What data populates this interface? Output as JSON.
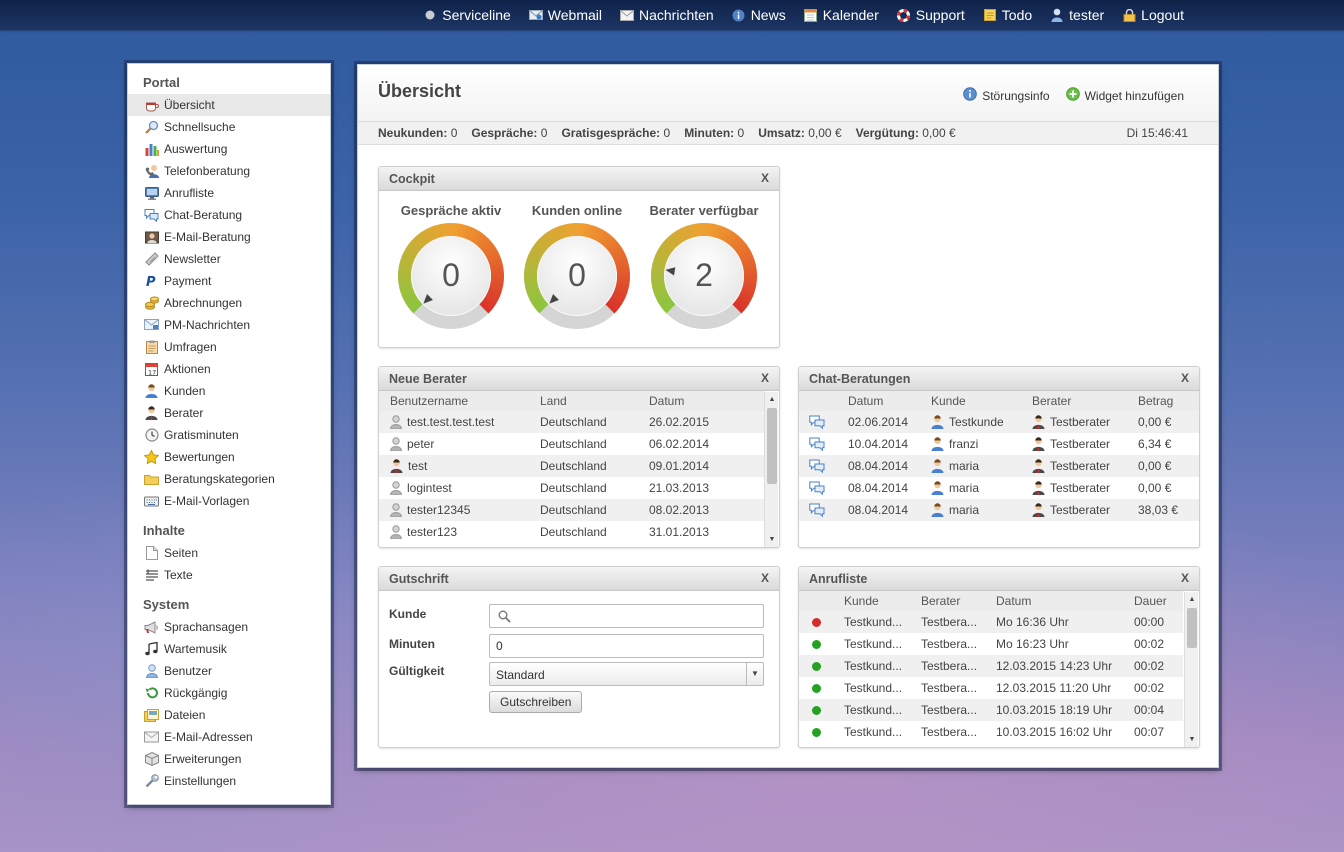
{
  "topnav": [
    {
      "label": "Serviceline",
      "icon": "status-dot-icon"
    },
    {
      "label": "Webmail",
      "icon": "webmail-icon"
    },
    {
      "label": "Nachrichten",
      "icon": "envelope-icon"
    },
    {
      "label": "News",
      "icon": "info-icon"
    },
    {
      "label": "Kalender",
      "icon": "calendar-icon"
    },
    {
      "label": "Support",
      "icon": "lifebuoy-icon"
    },
    {
      "label": "Todo",
      "icon": "note-icon"
    },
    {
      "label": "tester",
      "icon": "user-icon"
    },
    {
      "label": "Logout",
      "icon": "lock-icon"
    }
  ],
  "sidebar": {
    "sections": [
      {
        "title": "Portal",
        "items": [
          {
            "label": "Übersicht",
            "icon": "coffee-cup-icon",
            "active": true
          },
          {
            "label": "Schnellsuche",
            "icon": "magnifier-icon"
          },
          {
            "label": "Auswertung",
            "icon": "bar-chart-icon"
          },
          {
            "label": "Telefonberatung",
            "icon": "phone-user-icon"
          },
          {
            "label": "Anrufliste",
            "icon": "monitor-icon"
          },
          {
            "label": "Chat-Beratung",
            "icon": "chat-bubbles-icon"
          },
          {
            "label": "E-Mail-Beratung",
            "icon": "mail-user-icon"
          },
          {
            "label": "Newsletter",
            "icon": "newsletter-icon"
          },
          {
            "label": "Payment",
            "icon": "paypal-icon"
          },
          {
            "label": "Abrechnungen",
            "icon": "coins-icon"
          },
          {
            "label": "PM-Nachrichten",
            "icon": "pm-message-icon"
          },
          {
            "label": "Umfragen",
            "icon": "clipboard-icon"
          },
          {
            "label": "Aktionen",
            "icon": "calendar-icon"
          },
          {
            "label": "Kunden",
            "icon": "customer-icon"
          },
          {
            "label": "Berater",
            "icon": "advisor-icon"
          },
          {
            "label": "Gratisminuten",
            "icon": "clock-icon"
          },
          {
            "label": "Bewertungen",
            "icon": "star-icon"
          },
          {
            "label": "Beratungskategorien",
            "icon": "folder-icon"
          },
          {
            "label": "E-Mail-Vorlagen",
            "icon": "keyboard-icon"
          }
        ]
      },
      {
        "title": "Inhalte",
        "items": [
          {
            "label": "Seiten",
            "icon": "page-icon"
          },
          {
            "label": "Texte",
            "icon": "text-icon"
          }
        ]
      },
      {
        "title": "System",
        "items": [
          {
            "label": "Sprachansagen",
            "icon": "megaphone-icon"
          },
          {
            "label": "Wartemusik",
            "icon": "music-note-icon"
          },
          {
            "label": "Benutzer",
            "icon": "user-icon"
          },
          {
            "label": "Rückgängig",
            "icon": "undo-icon"
          },
          {
            "label": "Dateien",
            "icon": "files-icon"
          },
          {
            "label": "E-Mail-Adressen",
            "icon": "address-icon"
          },
          {
            "label": "Erweiterungen",
            "icon": "box-icon"
          },
          {
            "label": "Einstellungen",
            "icon": "wrench-icon"
          }
        ]
      }
    ]
  },
  "main": {
    "title": "Übersicht",
    "links": {
      "stoerungsinfo": "Störungsinfo",
      "add_widget": "Widget hinzufügen"
    },
    "stats": [
      {
        "label": "Neukunden:",
        "value": "0"
      },
      {
        "label": "Gespräche:",
        "value": "0"
      },
      {
        "label": "Gratisgespräche:",
        "value": "0"
      },
      {
        "label": "Minuten:",
        "value": "0"
      },
      {
        "label": "Umsatz:",
        "value": "0,00 €"
      },
      {
        "label": "Vergütung:",
        "value": "0,00 €"
      }
    ],
    "clock": "Di 15:46:41"
  },
  "cockpit": {
    "title": "Cockpit",
    "close": "X",
    "gauges": [
      {
        "label": "Gespräche aktiv",
        "value": "0",
        "fraction": 0.0
      },
      {
        "label": "Kunden online",
        "value": "0",
        "fraction": 0.0
      },
      {
        "label": "Berater verfügbar",
        "value": "2",
        "fraction": 0.2
      }
    ]
  },
  "neue_berater": {
    "title": "Neue Berater",
    "close": "X",
    "columns": [
      "Benutzername",
      "Land",
      "Datum"
    ],
    "rows": [
      {
        "name": "test.test.test.test",
        "land": "Deutschland",
        "datum": "26.02.2015",
        "icon": "user-gray-icon"
      },
      {
        "name": "peter",
        "land": "Deutschland",
        "datum": "06.02.2014",
        "icon": "user-gray-icon"
      },
      {
        "name": "test",
        "land": "Deutschland",
        "datum": "09.01.2014",
        "icon": "advisor-icon"
      },
      {
        "name": "logintest",
        "land": "Deutschland",
        "datum": "21.03.2013",
        "icon": "user-gray-icon"
      },
      {
        "name": "tester12345",
        "land": "Deutschland",
        "datum": "08.02.2013",
        "icon": "user-gray-icon"
      },
      {
        "name": "tester123",
        "land": "Deutschland",
        "datum": "31.01.2013",
        "icon": "user-gray-icon"
      }
    ]
  },
  "chat_beratungen": {
    "title": "Chat-Beratungen",
    "close": "X",
    "columns": [
      "Datum",
      "Kunde",
      "Berater",
      "Betrag"
    ],
    "rows": [
      {
        "datum": "02.06.2014",
        "kunde": "Testkunde",
        "berater": "Testberater",
        "betrag": "0,00 €"
      },
      {
        "datum": "10.04.2014",
        "kunde": "franzi",
        "berater": "Testberater",
        "betrag": "6,34 €"
      },
      {
        "datum": "08.04.2014",
        "kunde": "maria",
        "berater": "Testberater",
        "betrag": "0,00 €"
      },
      {
        "datum": "08.04.2014",
        "kunde": "maria",
        "berater": "Testberater",
        "betrag": "0,00 €"
      },
      {
        "datum": "08.04.2014",
        "kunde": "maria",
        "berater": "Testberater",
        "betrag": "38,03 €"
      }
    ]
  },
  "gutschrift": {
    "title": "Gutschrift",
    "close": "X",
    "kunde_label": "Kunde",
    "kunde_value": "",
    "minuten_label": "Minuten",
    "minuten_value": "0",
    "gueltigkeit_label": "Gültigkeit",
    "gueltigkeit_value": "Standard",
    "submit": "Gutschreiben"
  },
  "anrufliste": {
    "title": "Anrufliste",
    "close": "X",
    "columns": [
      "Kunde",
      "Berater",
      "Datum",
      "Dauer"
    ],
    "rows": [
      {
        "status": "red",
        "kunde": "Testkund...",
        "berater": "Testbera...",
        "datum": "Mo 16:36 Uhr",
        "dauer": "00:00"
      },
      {
        "status": "green",
        "kunde": "Testkund...",
        "berater": "Testbera...",
        "datum": "Mo 16:23 Uhr",
        "dauer": "00:02"
      },
      {
        "status": "green",
        "kunde": "Testkund...",
        "berater": "Testbera...",
        "datum": "12.03.2015 14:23 Uhr",
        "dauer": "00:02"
      },
      {
        "status": "green",
        "kunde": "Testkund...",
        "berater": "Testbera...",
        "datum": "12.03.2015 11:20 Uhr",
        "dauer": "00:02"
      },
      {
        "status": "green",
        "kunde": "Testkund...",
        "berater": "Testbera...",
        "datum": "10.03.2015 18:19 Uhr",
        "dauer": "00:04"
      },
      {
        "status": "green",
        "kunde": "Testkund...",
        "berater": "Testbera...",
        "datum": "10.03.2015 16:02 Uhr",
        "dauer": "00:07"
      }
    ]
  },
  "colors": {
    "status_red": "#d42b2b",
    "status_green": "#23a321",
    "gauge_green": "#8cc63f",
    "gauge_orange": "#f0a030",
    "gauge_red": "#d9302a"
  }
}
